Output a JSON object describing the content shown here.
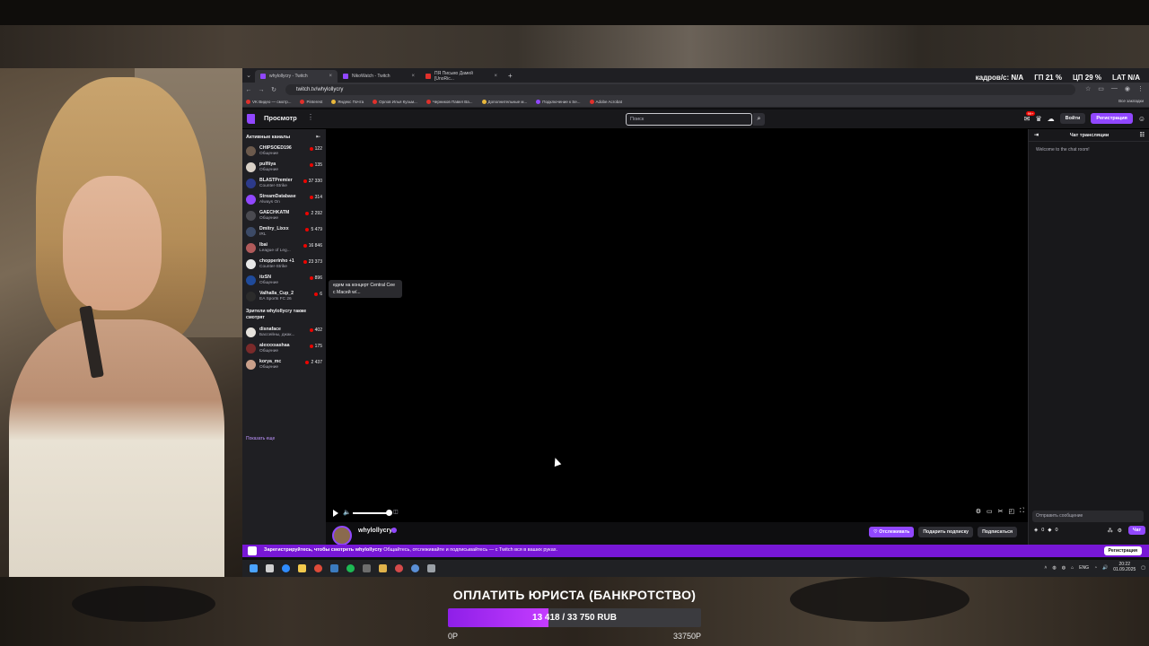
{
  "browser": {
    "tabs": [
      {
        "label": "whylollycry - Twitch",
        "active": true,
        "icon": "twitch-icon"
      },
      {
        "label": "NikoWatch - Twitch",
        "active": false,
        "icon": "twitch-icon"
      },
      {
        "label": "ПЯ Письмо Дамей [UnoRic...",
        "active": false,
        "icon": "youtube-icon"
      }
    ],
    "url": "twitch.tv/whylollycry",
    "bookmarks": [
      "VK Видео — смотр...",
      "Pinterest",
      "Яндекс Почта",
      "Орлов Илья Кузьм...",
      "Черников Павел Ва...",
      "Дополнительные м...",
      "Подключение к Se...",
      "Adobe Acrobat"
    ],
    "bookmarks_all": "Все закладки",
    "stats": {
      "fps_label": "кадров/с:",
      "fps": "N/A",
      "gpu_label": "ГП",
      "gpu": "21 %",
      "cpu_label": "ЦП",
      "cpu": "29 %",
      "lat_label": "LAT",
      "lat": "N/A"
    }
  },
  "twitch": {
    "browse": "Просмотр",
    "search_placeholder": "Поиск",
    "notifications_count": "99+",
    "login": "Войти",
    "register": "Регистрация",
    "sidebar": {
      "active_header": "Активные каналы",
      "channels": [
        {
          "name": "CHIPSOED196",
          "game": "Общение",
          "viewers": "122"
        },
        {
          "name": "pulfiiya",
          "game": "Общение",
          "viewers": "135"
        },
        {
          "name": "BLASTPremier",
          "game": "Counter-Strike",
          "viewers": "37 330"
        },
        {
          "name": "StreamDatabase",
          "game": "Always On",
          "viewers": "314"
        },
        {
          "name": "GAECHKATM",
          "game": "Общение",
          "viewers": "2 292"
        },
        {
          "name": "Dmitry_Lixxx",
          "game": "IRL",
          "viewers": "5 479"
        },
        {
          "name": "Ibai",
          "game": "League of Leg...",
          "viewers": "16 846"
        },
        {
          "name": "chopperinho +1",
          "game": "Counter-Strike",
          "viewers": "23 373"
        },
        {
          "name": "itzSN",
          "game": "Общение",
          "viewers": "896"
        },
        {
          "name": "Valhalla_Cup_2",
          "game": "EA Sports FC 26",
          "viewers": "6"
        }
      ],
      "also_header": "Зрители whylollycry также смотрят",
      "also_channels": [
        {
          "name": "disnaface",
          "game": "Бассейны, джак...",
          "viewers": "402"
        },
        {
          "name": "alexxxsashaa",
          "game": "Общение",
          "viewers": "175"
        },
        {
          "name": "korya_mc",
          "game": "Общение",
          "viewers": "2 437"
        }
      ],
      "show_more": "Показать еще",
      "tooltip": "едем на концерт Central Cee с Масей w/..."
    },
    "channel": {
      "name": "whylollycry",
      "follow": "♡ Отслеживать",
      "gift": "Подарить подписку",
      "subscribe": "Подписаться"
    },
    "chat": {
      "header": "Чат трансляции",
      "welcome": "Welcome to the chat room!",
      "input_placeholder": "Отправить сообщение",
      "points": "0",
      "send": "Чат"
    },
    "banner": {
      "bold": "Зарегистрируйтесь, чтобы смотреть whylollycry",
      "text": "Общайтесь, отслеживайте и подписывайтесь — с Twitch вся в ваших руках.",
      "button": "Регистрация"
    }
  },
  "taskbar": {
    "lang": "ENG",
    "time": "20:22",
    "date": "01.09.2025"
  },
  "goal": {
    "title": "ОПЛАТИТЬ ЮРИСТА (БАНКРОТСТВО)",
    "progress_text": "13 418 / 33 750 RUB",
    "current": 13418,
    "target": 33750,
    "min_label": "0Р",
    "max_label": "33750Р"
  },
  "colors": {
    "twitch_purple": "#9147ff",
    "goal_fill": "#b02ef5"
  }
}
